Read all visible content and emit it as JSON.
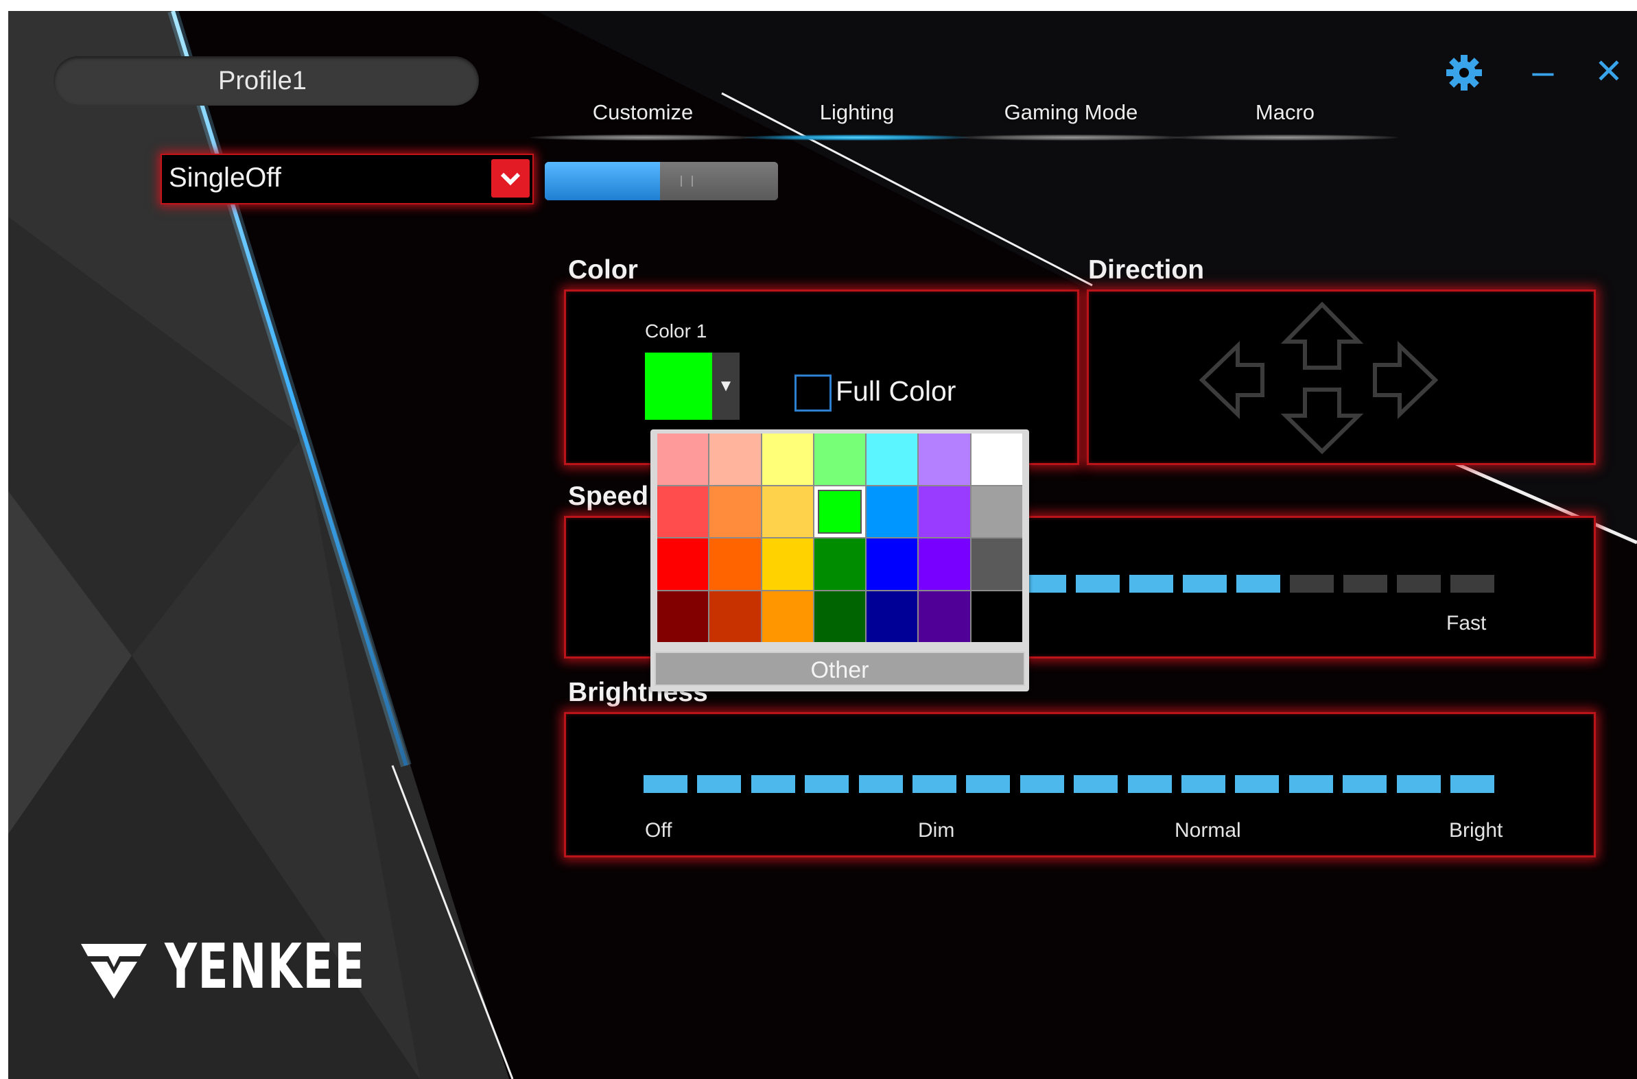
{
  "profile": {
    "name": "Profile1"
  },
  "tabs": [
    {
      "label": "Customize",
      "active": false
    },
    {
      "label": "Lighting",
      "active": true
    },
    {
      "label": "Gaming Mode",
      "active": false
    },
    {
      "label": "Macro",
      "active": false
    }
  ],
  "window_controls": {
    "settings_icon": "gear-icon",
    "minimize_icon": "minimize-icon",
    "minimize_glyph": "–",
    "close_icon": "close-icon",
    "close_glyph": "✕"
  },
  "mode": {
    "selected": "SingleOff",
    "toggle_on": true
  },
  "color_section": {
    "heading": "Color",
    "color1_label": "Color 1",
    "color1_value": "#00ff00",
    "dropdown_glyph": "▼",
    "full_color_label": "Full Color",
    "full_color_checked": false
  },
  "direction_section": {
    "heading": "Direction",
    "arrows": [
      "left-arrow-icon",
      "up-arrow-icon",
      "right-arrow-icon",
      "down-arrow-icon"
    ]
  },
  "speed_section": {
    "heading": "Speed",
    "labels": {
      "fast": "Fast"
    },
    "segments_visible_on": 5,
    "segments_visible_off": 4
  },
  "brightness_section": {
    "heading": "Brightness",
    "level": 1.0,
    "segment_count": 16,
    "labels": [
      "Off",
      "Dim",
      "Normal",
      "Bright"
    ]
  },
  "palette": {
    "colors": [
      [
        "#ff9a9a",
        "#ffb49e",
        "#ffff78",
        "#78ff78",
        "#5af5ff",
        "#b480ff",
        "#ffffff"
      ],
      [
        "#ff4c4c",
        "#ff8c3c",
        "#ffd24c",
        "#00ff00",
        "#0096ff",
        "#9a3cff",
        "#a0a0a0"
      ],
      [
        "#ff0000",
        "#ff6400",
        "#ffd200",
        "#008c00",
        "#0000ff",
        "#7800ff",
        "#5a5a5a"
      ],
      [
        "#820000",
        "#c83200",
        "#ff9600",
        "#006400",
        "#000096",
        "#500096",
        "#000000"
      ]
    ],
    "selected_row": 1,
    "selected_col": 3,
    "other_label": "Other"
  },
  "brand": {
    "logo_text": "YENKEE"
  },
  "colors": {
    "accent_blue": "#4db8ec",
    "panel_red": "#c4141a"
  }
}
